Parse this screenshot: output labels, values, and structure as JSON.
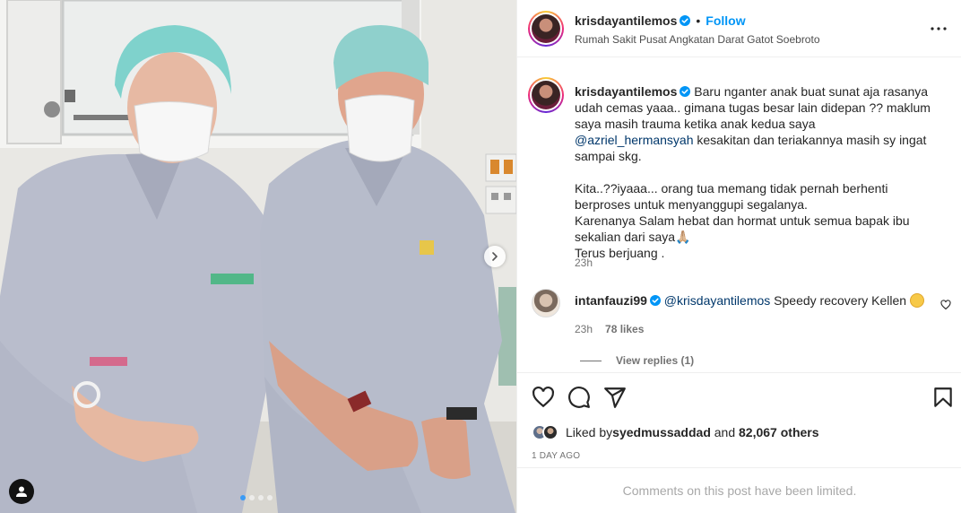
{
  "post": {
    "username": "krisdayantilemos",
    "separator": "•",
    "follow_label": "Follow",
    "location": "Rumah Sakit Pusat Angkatan Darat Gatot Soebroto",
    "more_icon": "more-horizontal-icon"
  },
  "caption": {
    "username": "krisdayantilemos",
    "text_1": " Baru nganter anak buat sunat aja rasanya udah cemas yaaa.. gimana tugas besar lain didepan ?? maklum saya masih trauma ketika anak kedua saya ",
    "mention": "@azriel_hermansyah",
    "text_2": " kesakitan dan teriakannya masih sy ingat sampai skg.",
    "text_3": "Kita..??iyaaa... orang tua memang tidak pernah berhenti berproses untuk menyanggupi segalanya.",
    "text_4": "Karenanya Salam hebat dan hormat untuk semua bapak ibu sekalian dari saya🙏🏼",
    "text_5": "Terus berjuang .",
    "time": "23h"
  },
  "comment": {
    "username": "intanfauzi99",
    "mention": "@krisdayantilemos",
    "text": " Speedy recovery Kellen ",
    "time": "23h",
    "likes": "78 likes",
    "view_replies": "View replies (1)"
  },
  "likes": {
    "prefix": "Liked by ",
    "user": "syedmussaddad",
    "middle": " and ",
    "count": "82,067 others"
  },
  "time_ago": "1 DAY AGO",
  "comments_limited": "Comments on this post have been limited.",
  "carousel": {
    "total": 4,
    "active_index": 0
  },
  "colors": {
    "follow": "#0095f6",
    "verified": "#0095f6",
    "scrub": "#b7bccb",
    "cap": "#8fd3cf",
    "muted": "#737373"
  }
}
